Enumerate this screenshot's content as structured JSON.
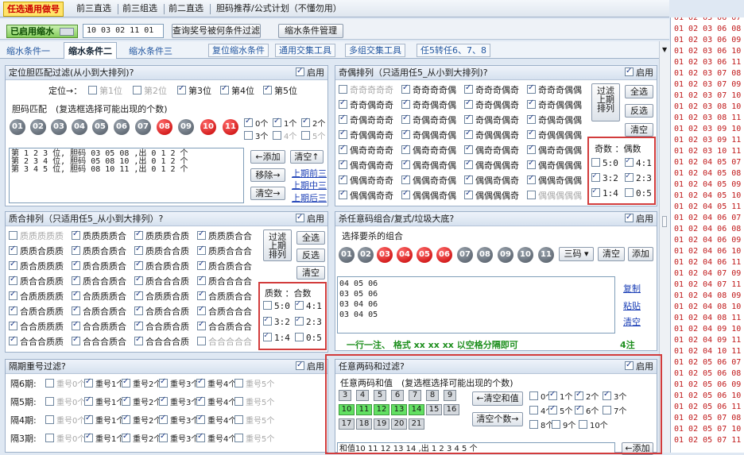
{
  "top_tabs": [
    "任选通用做号",
    "前三直选",
    "前三组选",
    "前二直选",
    "胆码推荐/公式计划（不懂勿用）"
  ],
  "toolbar": {
    "enabled_btn": "已启用缩水",
    "numbers_value": "10 03 02 11 01",
    "filter_btn": "查询奖号被何条件过滤",
    "manage_btn": "缩水条件管理"
  },
  "sub_tabs": [
    "缩水条件一",
    "缩水条件二",
    "缩水条件三"
  ],
  "link_tabs": [
    "复位缩水条件",
    "通用交集工具",
    "多组交集工具",
    "任5转任6、7、8"
  ],
  "enable_label": "启用",
  "dingwei": {
    "title": "定位胆匹配过滤(从小到大排列)?",
    "pos_label": "定位→：",
    "positions": [
      "第1位",
      "第2位",
      "第3位",
      "第4位",
      "第5位"
    ],
    "match_label": "胆码匹配　(复选框选择可能出现的个数)",
    "balls": [
      "01",
      "02",
      "03",
      "04",
      "05",
      "06",
      "07",
      "08",
      "09",
      "10",
      "11"
    ],
    "counts": [
      "0个",
      "1个",
      "2个",
      "3个",
      "4个",
      "5个"
    ],
    "text": "第 1 2 3 位, 胆码 03 05 08 ,出 0 1 2 个\n第 2 3 4 位, 胆码 05 08 10 ,出 0 1 2 个\n第 3 4 5 位, 胆码 08 10 11 ,出 0 1 2 个",
    "add": "←添加",
    "clear_up": "清空↑",
    "move": "移除→",
    "clear_r": "清空→",
    "links": [
      "上期前三",
      "上期中三",
      "上期后三"
    ]
  },
  "jiou": {
    "title": "奇偶排列（只适用任5_从小到大排列)?",
    "rows": [
      [
        "奇奇奇奇奇",
        "奇奇奇奇偶",
        "奇奇奇偶奇",
        "奇奇奇偶偶"
      ],
      [
        "奇奇偶奇奇",
        "奇奇偶奇偶",
        "奇奇偶偶奇",
        "奇奇偶偶偶"
      ],
      [
        "奇偶奇奇奇",
        "奇偶奇奇偶",
        "奇偶奇偶奇",
        "奇偶奇偶偶"
      ],
      [
        "奇偶偶奇奇",
        "奇偶偶奇偶",
        "奇偶偶偶奇",
        "奇偶偶偶偶"
      ],
      [
        "偶奇奇奇奇",
        "偶奇奇奇偶",
        "偶奇奇偶奇",
        "偶奇奇偶偶"
      ],
      [
        "偶奇偶奇奇",
        "偶奇偶奇偶",
        "偶奇偶偶奇",
        "偶奇偶偶偶"
      ],
      [
        "偶偶奇奇奇",
        "偶偶奇奇偶",
        "偶偶奇偶奇",
        "偶偶奇偶偶"
      ],
      [
        "偶偶偶奇奇",
        "偶偶偶奇偶",
        "偶偶偶偶奇",
        "偶偶偶偶偶"
      ]
    ],
    "filter_btn": "过滤\n上期\n排列",
    "select_all": "全选",
    "invert": "反选",
    "clear": "清空",
    "ratio_title": "奇数 ：偶数",
    "ratios": [
      "5:0",
      "4:1",
      "3:2",
      "2:3",
      "1:4",
      "0:5"
    ]
  },
  "zhihe": {
    "title": "质合排列（只适用任5_从小到大排列）?",
    "rows": [
      [
        "质质质质质",
        "质质质质合",
        "质质质合质",
        "质质质合合"
      ],
      [
        "质质合质质",
        "质质合质合",
        "质质合合质",
        "质质合合合"
      ],
      [
        "质合质质质",
        "质合质质合",
        "质合质合质",
        "质合质合合"
      ],
      [
        "质合合质质",
        "质合合质合",
        "质合合合质",
        "质合合合合"
      ],
      [
        "合质质质质",
        "合质质质合",
        "合质质合质",
        "合质质合合"
      ],
      [
        "合质合质质",
        "合质合质合",
        "合质合合质",
        "合质合合合"
      ],
      [
        "合合质质质",
        "合合质质合",
        "合合质合质",
        "合合质合合"
      ],
      [
        "合合合质质",
        "合合合质合",
        "合合合合质",
        "合合合合合"
      ]
    ],
    "filter_btn": "过滤\n上期\n排列",
    "select_all": "全选",
    "invert": "反选",
    "clear": "清空",
    "ratio_title": "质数 ：合数",
    "ratios": [
      "5:0",
      "4:1",
      "3:2",
      "2:3",
      "1:4",
      "0:5"
    ]
  },
  "shama": {
    "title": "杀任意码组合/复式/垃圾大底?",
    "sub": "选择要杀的组合",
    "balls": [
      "01",
      "02",
      "03",
      "04",
      "05",
      "06",
      "07",
      "08",
      "09",
      "10",
      "11"
    ],
    "select": "三码 ▾",
    "clear": "清空",
    "add": "添加",
    "text": "04 05 06\n03 05 06\n03 04 06\n03 04 05",
    "links": [
      "复制",
      "粘贴",
      "清空"
    ],
    "hint": "一行一注、 格式 xx xx xx 以空格分隔即可",
    "count": "4注"
  },
  "chonghao": {
    "title": "隔期重号过滤?",
    "rows": [
      "隔6期:",
      "隔5期:",
      "隔4期:",
      "隔3期:"
    ],
    "opts": [
      "重号0个",
      "重号1个",
      "重号2个",
      "重号3个",
      "重号4个",
      "重号5个"
    ]
  },
  "hezhi": {
    "title": "任意两码和过滤?",
    "sub": "任意两码和值　(复选框选择可能出现的个数)",
    "nums": [
      "3",
      "4",
      "5",
      "6",
      "7",
      "8",
      "9",
      "10",
      "11",
      "12",
      "13",
      "14",
      "15",
      "16",
      "17",
      "18",
      "19",
      "20",
      "21"
    ],
    "btn_add": "←清空和值",
    "btn_clear": "清空个数→",
    "counts": [
      "0个",
      "1个",
      "2个",
      "3个",
      "4个",
      "5个",
      "6个",
      "7个",
      "8个",
      "9个",
      "10个"
    ],
    "text": "和值10 11 12 13 14 ,出 1 2 3 4 5 个",
    "add": "←添加"
  },
  "right_list": [
    "01 02 03 06 07",
    "01 02 03 06 08",
    "01 02 03 06 09",
    "01 02 03 06 10",
    "01 02 03 06 11",
    "01 02 03 07 08",
    "01 02 03 07 09",
    "01 02 03 07 10",
    "01 02 03 08 10",
    "01 02 03 08 11",
    "01 02 03 09 10",
    "01 02 03 09 11",
    "01 02 03 10 11",
    "01 02 04 05 07",
    "01 02 04 05 08",
    "01 02 04 05 09",
    "01 02 04 05 10",
    "01 02 04 05 11",
    "01 02 04 06 07",
    "01 02 04 06 08",
    "01 02 04 06 09",
    "01 02 04 06 10",
    "01 02 04 06 11",
    "01 02 04 07 09",
    "01 02 04 07 11",
    "01 02 04 08 09",
    "01 02 04 08 10",
    "01 02 04 08 11",
    "01 02 04 09 10",
    "01 02 04 09 11",
    "01 02 04 10 11",
    "01 02 05 06 07",
    "01 02 05 06 08",
    "01 02 05 06 09",
    "01 02 05 06 10",
    "01 02 05 06 11",
    "01 02 05 07 08",
    "01 02 05 07 10",
    "01 02 05 07 11"
  ]
}
